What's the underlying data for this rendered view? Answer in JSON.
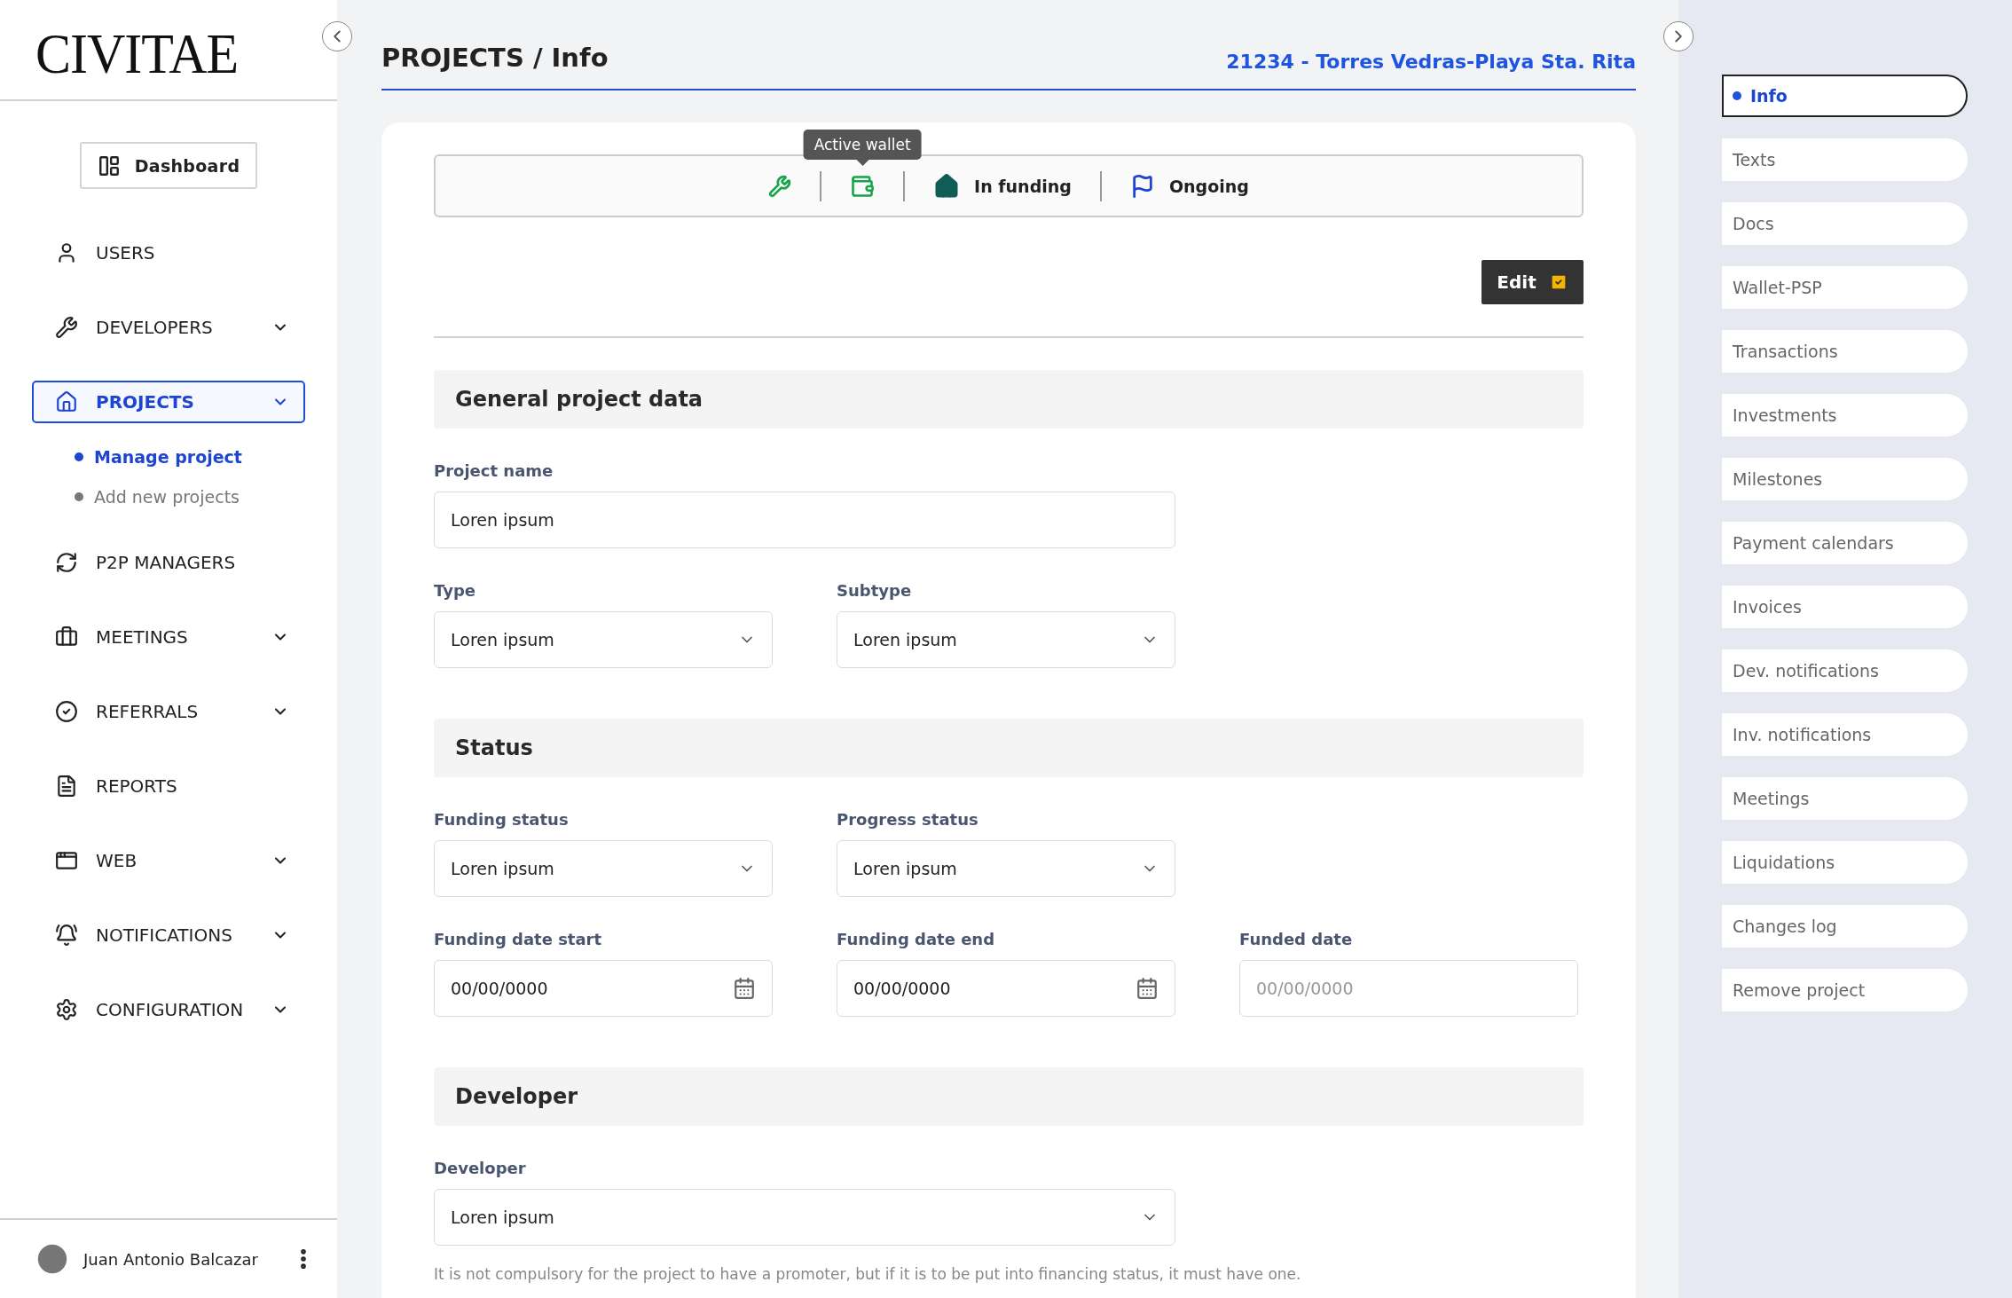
{
  "sidebar": {
    "logo": "CIVITAE",
    "dashboard_button": "Dashboard",
    "nav_items": [
      {
        "label": "USERS",
        "has_submenu": false,
        "selected": false
      },
      {
        "label": "DEVELOPERS",
        "has_submenu": true,
        "selected": false
      },
      {
        "label": "PROJECTS",
        "has_submenu": true,
        "selected": true,
        "children": [
          {
            "label": "Manage project",
            "selected": true
          },
          {
            "label": "Add new projects",
            "selected": false
          }
        ]
      },
      {
        "label": "P2P MANAGERS",
        "has_submenu": false,
        "selected": false
      },
      {
        "label": "MEETINGS",
        "has_submenu": true,
        "selected": false
      },
      {
        "label": "REFERRALS",
        "has_submenu": true,
        "selected": false
      },
      {
        "label": "REPORTS",
        "has_submenu": false,
        "selected": false
      },
      {
        "label": "WEB",
        "has_submenu": true,
        "selected": false
      },
      {
        "label": "NOTIFICATIONS",
        "has_submenu": true,
        "selected": false
      },
      {
        "label": "CONFIGURATION",
        "has_submenu": true,
        "selected": false
      }
    ],
    "user": {
      "name": "Juan Antonio Balcazar"
    }
  },
  "header": {
    "title": "PROJECTS / Info",
    "project": "21234 - Torres Vedras-Playa Sta. Rita"
  },
  "status_bar": {
    "items": [
      {
        "kind": "developer"
      },
      {
        "kind": "wallet",
        "tooltip": "Active wallet"
      },
      {
        "kind": "funding",
        "label": "In funding"
      },
      {
        "kind": "progress",
        "label": "Ongoing"
      }
    ]
  },
  "edit_button": "Edit",
  "sections": [
    {
      "title": "General project data",
      "rows": [
        [
          {
            "label": "Project name",
            "kind": "text",
            "value": "Loren ipsum"
          }
        ],
        [
          {
            "label": "Type",
            "kind": "select",
            "value": "Loren ipsum"
          },
          {
            "label": "Subtype",
            "kind": "select",
            "value": "Loren ipsum"
          }
        ]
      ]
    },
    {
      "title": "Status",
      "rows": [
        [
          {
            "label": "Funding status",
            "kind": "select",
            "value": "Loren ipsum"
          },
          {
            "label": "Progress status",
            "kind": "select",
            "value": "Loren ipsum"
          }
        ],
        [
          {
            "label": "Funding date start",
            "kind": "date",
            "value": "00/00/0000"
          },
          {
            "label": "Funding date end",
            "kind": "date",
            "value": "00/00/0000"
          },
          {
            "label": "Funded date",
            "kind": "text",
            "placeholder": "00/00/0000"
          }
        ]
      ]
    },
    {
      "title": "Developer",
      "rows": [
        [
          {
            "label": "Developer",
            "kind": "select",
            "value": "Loren ipsum"
          }
        ]
      ],
      "note": "It is not compulsory for the project to have a promoter, but if it is to be put into financing status, it must have one."
    }
  ],
  "right_nav": {
    "items": [
      {
        "label": "Info",
        "selected": true
      },
      {
        "label": "Texts",
        "selected": false
      },
      {
        "label": "Docs",
        "selected": false
      },
      {
        "label": "Wallet-PSP",
        "selected": false
      },
      {
        "label": "Transactions",
        "selected": false
      },
      {
        "label": "Investments",
        "selected": false
      },
      {
        "label": "Milestones",
        "selected": false
      },
      {
        "label": "Payment calendars",
        "selected": false
      },
      {
        "label": "Invoices",
        "selected": false
      },
      {
        "label": "Dev. notifications",
        "selected": false
      },
      {
        "label": "Inv. notifications",
        "selected": false
      },
      {
        "label": "Meetings",
        "selected": false
      },
      {
        "label": "Liquidations",
        "selected": false
      },
      {
        "label": "Changes log",
        "selected": false
      },
      {
        "label": "Remove project",
        "selected": false
      }
    ]
  }
}
